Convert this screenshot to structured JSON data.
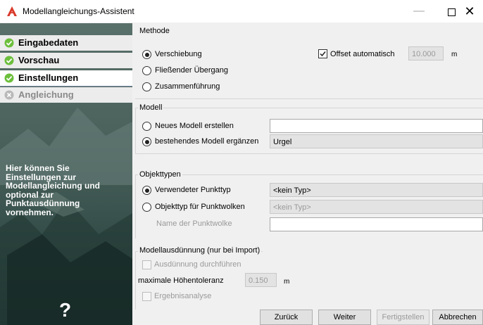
{
  "window": {
    "title": "Modellangleichungs-Assistent",
    "accent": "#c0392b"
  },
  "sidebar": {
    "items": [
      {
        "label": "Eingabedaten",
        "icon": "check-icon",
        "state": "done"
      },
      {
        "label": "Vorschau",
        "icon": "check-icon",
        "state": "done"
      },
      {
        "label": "Einstellungen",
        "icon": "check-icon",
        "state": "selected"
      },
      {
        "label": "Angleichung",
        "icon": "disabled-check-icon",
        "state": "disabled"
      }
    ],
    "description": "Hier können Sie\nEinstellungen zur\nModellangleichung und\noptional zur\nPunktausdünnung\nvornehmen.",
    "help": "?"
  },
  "methode": {
    "title": "Methode",
    "options": [
      "Verschiebung",
      "Fließender Übergang",
      "Zusammenführung"
    ],
    "selected": 0,
    "offset_label": "Offset automatisch",
    "offset_checked": true,
    "offset_value": "10.000",
    "offset_unit": "m"
  },
  "modell": {
    "title": "Modell",
    "options": [
      "Neues Modell erstellen",
      "bestehendes Modell ergänzen"
    ],
    "selected": 1,
    "new_value": "",
    "existing_value": "Urgel"
  },
  "objekttypen": {
    "title": "Objekttypen",
    "options": [
      "Verwendeter Punkttyp",
      "Objekttyp für Punktwolken"
    ],
    "selected": 0,
    "punkttyp_value": "<kein Typ>",
    "objekttyp_value": "<kein Typ>",
    "name_label": "Name der Punktwolke",
    "name_value": ""
  },
  "ausduennung": {
    "title": "Modellausdünnung (nur bei Import)",
    "option": "Ausdünnung durchführen",
    "tolerance_label": "maximale Höhentoleranz",
    "tolerance_value": "0.150",
    "tolerance_unit": "m",
    "analysis_label": "Ergebnisanalyse"
  },
  "buttons": {
    "back": "Zurück",
    "next": "Weiter",
    "finish": "Fertigstellen",
    "cancel": "Abbrechen"
  }
}
